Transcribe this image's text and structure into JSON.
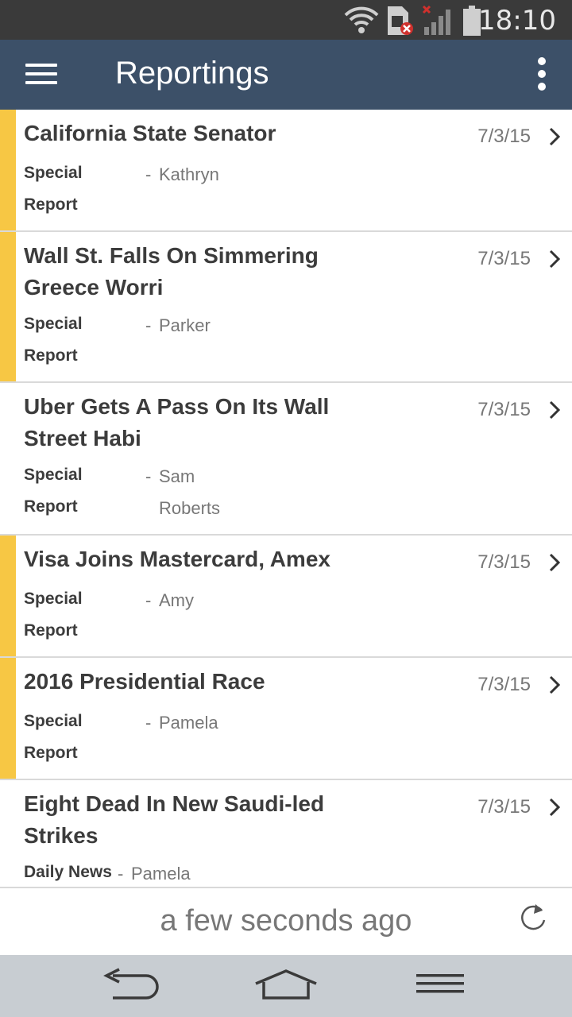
{
  "status_bar": {
    "time": "18:10",
    "icons": [
      "wifi-icon",
      "sim-error-icon",
      "signal-icon",
      "battery-icon"
    ]
  },
  "app_bar": {
    "title": "Reportings",
    "menu_icon": "hamburger-menu-icon",
    "overflow_icon": "more-vert-icon"
  },
  "colors": {
    "app_bar": "#3c5068",
    "status_bar": "#3a3a3a",
    "flag": "#f7c744",
    "nav_bar": "#c8cdd2"
  },
  "reports": [
    {
      "title": "California State Senator",
      "date": "7/3/15",
      "category": "Special Report",
      "author": "Kathryn",
      "flagged": true
    },
    {
      "title": "Wall St. Falls On Simmering Greece Worri",
      "date": "7/3/15",
      "category": "Special Report",
      "author": "Parker",
      "flagged": true
    },
    {
      "title": "Uber Gets A Pass On Its Wall Street Habi",
      "date": "7/3/15",
      "category": "Special Report",
      "author": "Sam Roberts",
      "flagged": false
    },
    {
      "title": "Visa Joins Mastercard, Amex",
      "date": "7/3/15",
      "category": "Special Report",
      "author": "Amy",
      "flagged": true
    },
    {
      "title": "2016 Presidential Race",
      "date": "7/3/15",
      "category": "Special Report",
      "author": "Pamela",
      "flagged": true
    },
    {
      "title": "Eight Dead In New Saudi-led Strikes",
      "date": "7/3/15",
      "category": "Daily News",
      "author": "Pamela",
      "flagged": false
    }
  ],
  "footer": {
    "last_updated": "a few seconds ago",
    "refresh_icon": "refresh-icon"
  },
  "nav_bar": {
    "icons": [
      "back-icon",
      "home-icon",
      "menu-icon"
    ]
  }
}
